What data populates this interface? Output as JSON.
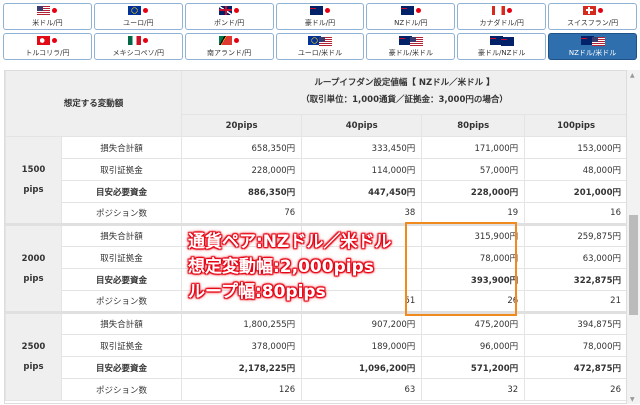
{
  "tabs": [
    {
      "label": "米ドル/円",
      "flag": "us",
      "active": false
    },
    {
      "label": "ユーロ/円",
      "flag": "eu",
      "active": false
    },
    {
      "label": "ポンド/円",
      "flag": "gb",
      "active": false
    },
    {
      "label": "豪ドル/円",
      "flag": "au",
      "active": false
    },
    {
      "label": "NZドル/円",
      "flag": "nz",
      "active": false
    },
    {
      "label": "カナダドル/円",
      "flag": "ca",
      "active": false
    },
    {
      "label": "スイスフラン/円",
      "flag": "ch",
      "active": false
    },
    {
      "label": "トルコリラ/円",
      "flag": "tr",
      "active": false
    },
    {
      "label": "メキシコペソ/円",
      "flag": "mx",
      "active": false
    },
    {
      "label": "南アランド/円",
      "flag": "za",
      "active": false
    },
    {
      "label": "ユーロ/米ドル",
      "flag": "eu-us",
      "active": false
    },
    {
      "label": "豪ドル/米ドル",
      "flag": "au-us",
      "active": false
    },
    {
      "label": "豪ドル/NZドル",
      "flag": "au-nz",
      "active": false
    },
    {
      "label": "NZドル/米ドル",
      "flag": "nz-us",
      "active": true
    }
  ],
  "table": {
    "corner": "想定する変動額",
    "title": "ループイフダン設定値幅【 NZドル／米ドル 】",
    "subtitle": "（取引単位：1,000通貨／証拠金：3,000円の場合）",
    "columns": [
      "20pips",
      "40pips",
      "80pips",
      "100pips"
    ],
    "groups": [
      {
        "name": "1500",
        "unit": "pips",
        "rows": [
          {
            "label": "損失合計額",
            "values": [
              "658,350円",
              "333,450円",
              "171,000円",
              "153,000円"
            ]
          },
          {
            "label": "取引証拠金",
            "values": [
              "228,000円",
              "114,000円",
              "57,000円",
              "48,000円"
            ]
          },
          {
            "label": "目安必要資金",
            "bold": true,
            "values": [
              "886,350円",
              "447,450円",
              "228,000円",
              "201,000円"
            ]
          },
          {
            "label": "ポジション数",
            "values": [
              "76",
              "38",
              "19",
              "16"
            ]
          }
        ]
      },
      {
        "name": "2000",
        "unit": "pips",
        "rows": [
          {
            "label": "損失合計額",
            "values": [
              "",
              "",
              "315,900円",
              "259,875円"
            ]
          },
          {
            "label": "取引証拠金",
            "values": [
              "",
              "",
              "78,000円",
              "63,000円"
            ]
          },
          {
            "label": "目安必要資金",
            "bold": true,
            "values": [
              "",
              "",
              "393,900円",
              "322,875円"
            ]
          },
          {
            "label": "ポジション数",
            "values": [
              "",
              "51",
              "26",
              "21"
            ]
          }
        ]
      },
      {
        "name": "2500",
        "unit": "pips",
        "rows": [
          {
            "label": "損失合計額",
            "values": [
              "1,800,255円",
              "907,200円",
              "475,200円",
              "394,875円"
            ]
          },
          {
            "label": "取引証拠金",
            "values": [
              "378,000円",
              "189,000円",
              "96,000円",
              "78,000円"
            ]
          },
          {
            "label": "目安必要資金",
            "bold": true,
            "values": [
              "2,178,225円",
              "1,096,200円",
              "571,200円",
              "472,875円"
            ]
          },
          {
            "label": "ポジション数",
            "values": [
              "126",
              "63",
              "32",
              "26"
            ]
          }
        ]
      }
    ]
  },
  "overlay": [
    "通貨ペア:NZドル／米ドル",
    "想定変動幅:2,000pips",
    "ループ幅:80pips"
  ],
  "colors": {
    "accent": "#2f6fae",
    "highlight": "#f08a1e",
    "overlay": "#e60012"
  }
}
